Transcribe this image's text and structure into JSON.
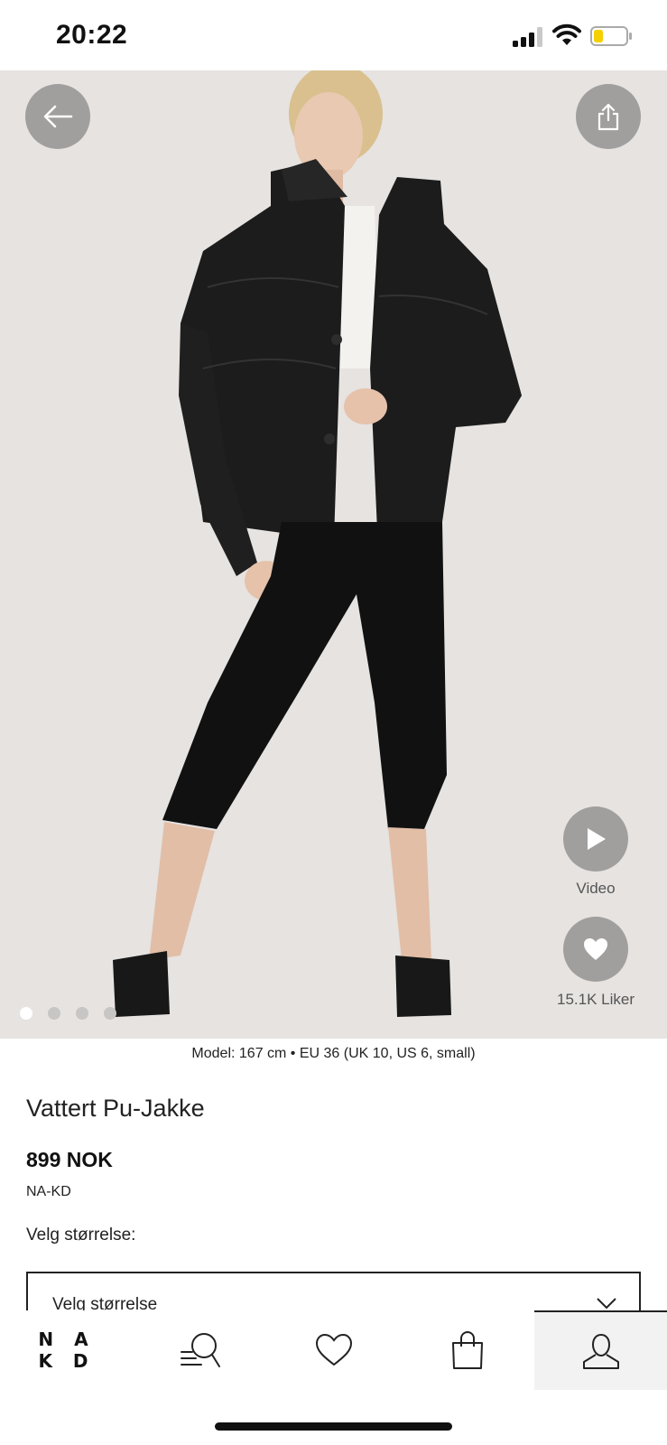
{
  "status_bar": {
    "time": "20:22"
  },
  "gallery": {
    "video_label": "Video",
    "likes_label": "15.1K Liker",
    "image_count": 4,
    "active_index": 0
  },
  "product": {
    "model_info": "Model: 167 cm • EU 36 (UK 10, US 6, small)",
    "title": "Vattert Pu-Jakke",
    "price": "899 NOK",
    "brand": "NA-KD",
    "size_label": "Velg størrelse:",
    "size_select_placeholder": "Velg størrelse"
  },
  "bottom_nav": {
    "logo_line1": "N A",
    "logo_line2": "K D",
    "items": [
      "home-logo",
      "search-icon",
      "heart-icon",
      "bag-icon",
      "profile-icon"
    ],
    "active": "profile-icon"
  },
  "colors": {
    "button_grey": "#a19f9e",
    "hero_background": "#e6e3e1",
    "battery_fill": "#f5d000"
  }
}
